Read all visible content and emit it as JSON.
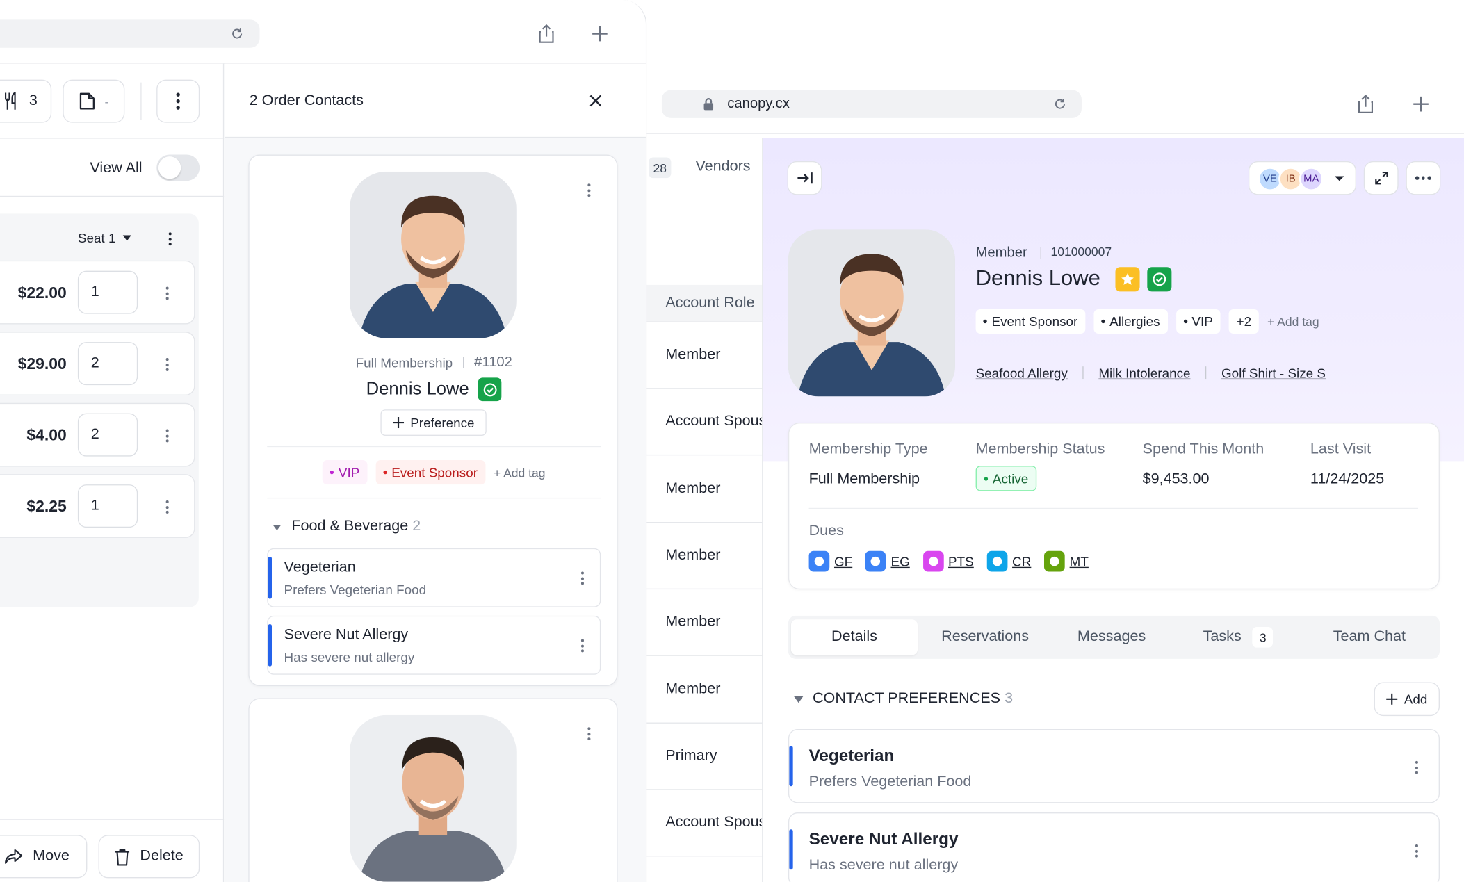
{
  "left_window": {
    "toolbar": {
      "utensils_count": "3",
      "doc_value": "-"
    },
    "view_all_label": "View All",
    "seat_label": "Seat 1",
    "items": [
      {
        "price": "$22.00",
        "qty": "1"
      },
      {
        "price": "$29.00",
        "qty": "2"
      },
      {
        "price": "$4.00",
        "qty": "2"
      },
      {
        "price": "$2.25",
        "qty": "1"
      }
    ],
    "move_label": "Move",
    "delete_label": "Delete",
    "contacts_panel": {
      "title": "2 Order Contacts",
      "contact": {
        "membership": "Full Membership",
        "member_no": "#1102",
        "name": "Dennis Lowe",
        "preference_button": "Preference",
        "tags": [
          {
            "label": "VIP",
            "color": "#c026d3",
            "bg": "#fdf2fb"
          },
          {
            "label": "Event Sponsor",
            "color": "#dc2626",
            "bg": "#fff1f0"
          }
        ],
        "add_tag": "+ Add tag",
        "section_title": "Food & Beverage",
        "section_count": "2",
        "preferences": [
          {
            "title": "Vegeterian",
            "subtitle": "Prefers Vegeterian Food"
          },
          {
            "title": "Severe Nut Allergy",
            "subtitle": "Has severe nut allergy"
          }
        ]
      }
    }
  },
  "right_window": {
    "url": "canopy.cx",
    "nav": {
      "count_badge": "28",
      "vendors": "Vendors"
    },
    "table": {
      "header": "Account Role",
      "rows": [
        "Member",
        "Account Spouse",
        "Member",
        "Member",
        "Member",
        "Member",
        "Primary",
        "Account Spouse"
      ]
    },
    "avatars": [
      "VE",
      "IB",
      "MA"
    ],
    "profile": {
      "role": "Member",
      "id": "101000007",
      "name": "Dennis Lowe",
      "tags": [
        "Event Sponsor",
        "Allergies",
        "VIP"
      ],
      "more_tags": "+2",
      "add_tag": "+ Add tag",
      "links": [
        "Seafood Allergy",
        "Milk Intolerance",
        "Golf Shirt - Size S"
      ]
    },
    "stats": {
      "membership_type_label": "Membership Type",
      "membership_type": "Full Membership",
      "membership_status_label": "Membership Status",
      "membership_status": "Active",
      "spend_label": "Spend This Month",
      "spend": "$9,453.00",
      "last_visit_label": "Last Visit",
      "last_visit": "11/24/2025",
      "dues_label": "Dues",
      "dues": [
        {
          "code": "GF",
          "color": "#3b82f6"
        },
        {
          "code": "EG",
          "color": "#3b82f6"
        },
        {
          "code": "PTS",
          "color": "#d946ef"
        },
        {
          "code": "CR",
          "color": "#0ea5e9"
        },
        {
          "code": "MT",
          "color": "#65a30d"
        }
      ]
    },
    "tabs": [
      {
        "label": "Details"
      },
      {
        "label": "Reservations"
      },
      {
        "label": "Messages"
      },
      {
        "label": "Tasks",
        "badge": "3"
      },
      {
        "label": "Team Chat"
      }
    ],
    "contact_prefs": {
      "title": "CONTACT PREFERENCES",
      "count": "3",
      "add_label": "Add",
      "items": [
        {
          "title": "Vegeterian",
          "subtitle": "Prefers Vegeterian Food"
        },
        {
          "title": "Severe Nut Allergy",
          "subtitle": "Has severe nut allergy"
        }
      ]
    }
  }
}
